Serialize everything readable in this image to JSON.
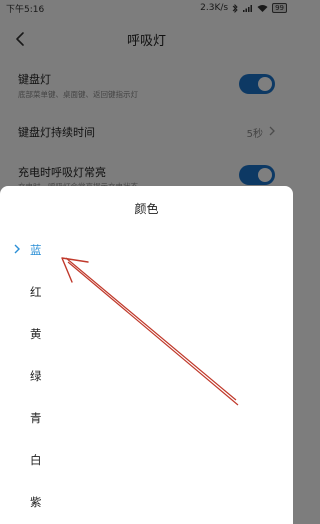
{
  "status_bar": {
    "time": "下午5:16",
    "network_speed": "2.3K/s",
    "battery": "99"
  },
  "header": {
    "title": "呼吸灯"
  },
  "settings": {
    "keyboard_light": {
      "title": "键盘灯",
      "subtitle": "底部菜单键、桌面键、返回键指示灯",
      "enabled": true
    },
    "keyboard_duration": {
      "title": "键盘灯持续时间",
      "value": "5秒"
    },
    "charging_light": {
      "title": "充电时呼吸灯常亮",
      "subtitle": "充电时，呼吸灯会常亮提示充电状态",
      "enabled": true
    }
  },
  "color_dialog": {
    "title": "颜色",
    "options": [
      "蓝",
      "红",
      "黄",
      "绿",
      "青",
      "白",
      "紫"
    ],
    "selected_index": 0
  },
  "colors": {
    "accent": "#1a73c9",
    "selected_text": "#2b8fd6",
    "annotation_arrow": "#c0392b"
  }
}
